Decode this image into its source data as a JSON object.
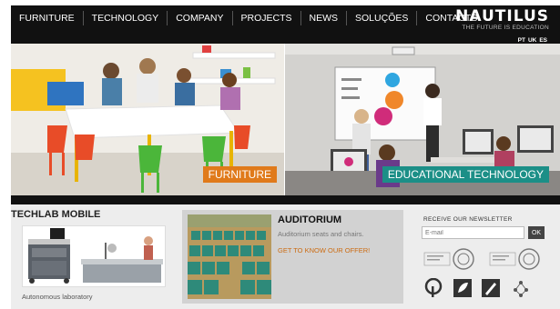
{
  "nav": {
    "items": [
      "FURNITURE",
      "TECHNOLOGY",
      "COMPANY",
      "PROJECTS",
      "NEWS",
      "SOLUÇÕES",
      "CONTACTS"
    ]
  },
  "brand": {
    "name": "NAUTILUS",
    "tagline": "THE FUTURE IS EDUCATION"
  },
  "languages": [
    "PT",
    "UK",
    "ES"
  ],
  "hero": {
    "left_label": "FURNITURE",
    "right_label": "EDUCATIONAL TECHNOLOGY"
  },
  "techlab": {
    "title": "TECHLAB MOBILE",
    "caption": "Autonomous laboratory"
  },
  "auditorium": {
    "title": "AUDITORIUM",
    "text": "Auditorium seats and chairs.",
    "cta": "GET TO KNOW OUR OFFER!"
  },
  "newsletter": {
    "title": "RECEIVE OUR NEWSLETTER",
    "placeholder": "E-mail",
    "button": "OK"
  },
  "colors": {
    "header_bg": "#111111",
    "furniture_label": "#e07a1a",
    "edu_label": "#1c8f87",
    "cta": "#cc6b11"
  }
}
